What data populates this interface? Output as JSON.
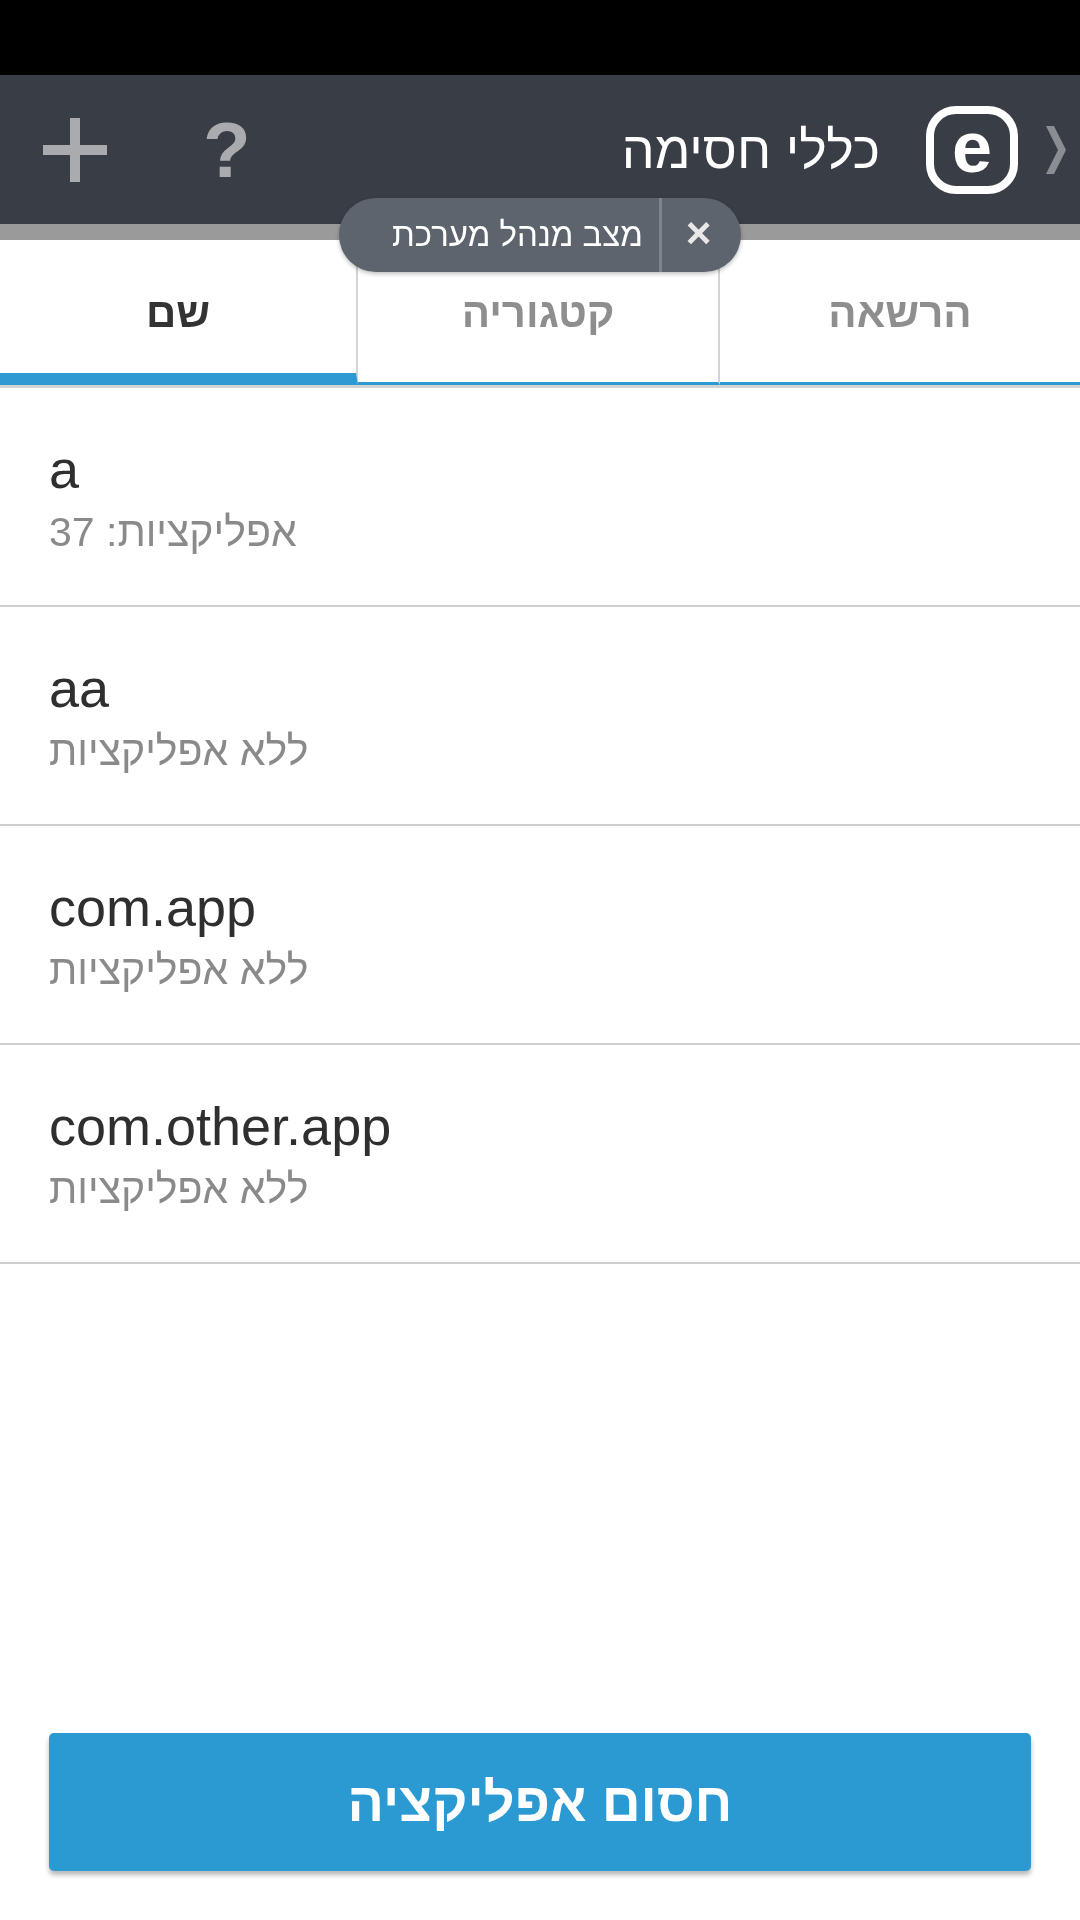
{
  "header": {
    "add_button": {
      "kind": "plus"
    },
    "help_button": {
      "label": "?"
    },
    "title": "כללי חסימה",
    "logo": {
      "letter": "e"
    }
  },
  "tooltip": {
    "text": "מצב מנהל מערכת",
    "close_label": "×"
  },
  "tabs": [
    {
      "label": "הרשאה",
      "selected": false
    },
    {
      "label": "קטגוריה",
      "selected": false
    },
    {
      "label": "שם",
      "selected": true
    }
  ],
  "rules": [
    {
      "name": "a",
      "detail": "אפליקציות: 37"
    },
    {
      "name": "aa",
      "detail": "ללא אפליקציות"
    },
    {
      "name": "com.app",
      "detail": "ללא אפליקציות"
    },
    {
      "name": "com.other.app",
      "detail": "ללא אפליקציות"
    }
  ],
  "primary_button": {
    "label": "חסום אפליקציה"
  }
}
